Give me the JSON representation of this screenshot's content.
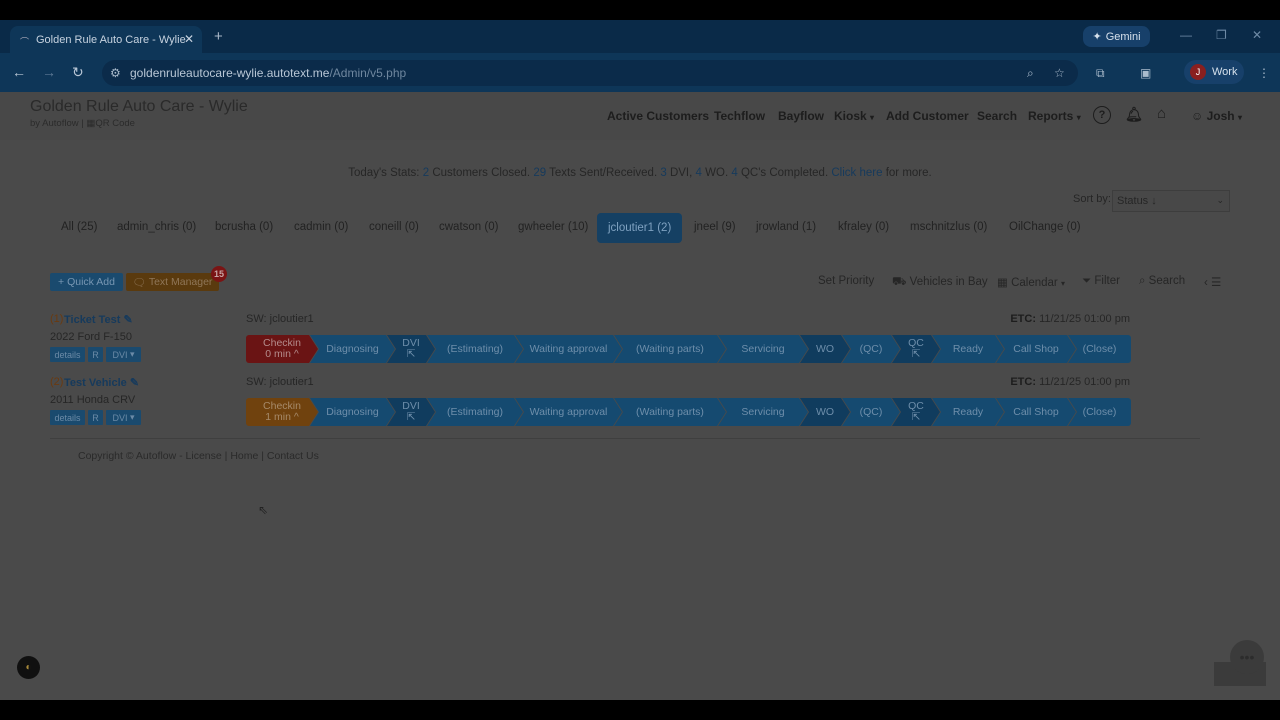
{
  "browser": {
    "tab_title": "Golden Rule Auto Care - Wylie",
    "gemini_label": "Gemini",
    "url_host": "goldenruleautocare-wylie.autotext.me",
    "url_path": "/Admin/v5.php",
    "profile_initial": "J",
    "profile_label": "Work"
  },
  "header": {
    "brand_title": "Golden Rule Auto Care - Wylie",
    "brand_by": "by Autoflow",
    "qr_label": "QR Code",
    "menu": [
      "Active Customers",
      "Techflow",
      "Bayflow",
      "Kiosk",
      "Add Customer",
      "Search",
      "Reports"
    ],
    "user": "Josh"
  },
  "stats": {
    "prefix": "Today's Stats:",
    "closed_count": "2",
    "closed_label": "Customers Closed.",
    "texts_count": "29",
    "texts_label": "Texts Sent/Received.",
    "dvi_count": "3",
    "dvi_label": "DVI,",
    "wo_count": "4",
    "wo_label": "WO.",
    "qc_count": "4",
    "qc_label": "QC's Completed.",
    "link": "Click here",
    "suffix": "for more."
  },
  "sort": {
    "label": "Sort by:",
    "value": "Status ↓"
  },
  "user_tabs": [
    "All (25)",
    "admin_chris (0)",
    "bcrusha (0)",
    "cadmin (0)",
    "coneill (0)",
    "cwatson (0)",
    "gwheeler (10)",
    "jcloutier1 (2)",
    "jneel (9)",
    "jrowland (1)",
    "kfraley (0)",
    "mschnitzlus (0)",
    "OilChange (0)"
  ],
  "toolbar": {
    "quick_add": "+ Quick Add",
    "text_manager": "Text Manager",
    "text_badge": "15",
    "set_priority": "Set Priority",
    "vehicles_in_bay": "Vehicles in Bay",
    "calendar": "Calendar",
    "filter": "Filter",
    "search": "Search"
  },
  "customers": [
    {
      "num": "(1)",
      "name": "Ticket Test",
      "vehicle": "2022 Ford F-150",
      "sw": "SW: jcloutier1",
      "etc_label": "ETC:",
      "etc_value": "11/21/25 01:00 pm",
      "checkin_line1": "Checkin",
      "checkin_line2": "0 min ^"
    },
    {
      "num": "(2)",
      "name": "Test Vehicle",
      "vehicle": "2011 Honda CRV",
      "sw": "SW: jcloutier1",
      "etc_label": "ETC:",
      "etc_value": "11/21/25 01:00 pm",
      "checkin_line1": "Checkin",
      "checkin_line2": "1 min ^"
    }
  ],
  "small_buttons": {
    "details": "details",
    "r": "R",
    "dvi": "DVI"
  },
  "stages": [
    "Diagnosing",
    "DVI",
    "(Estimating)",
    "Waiting approval",
    "(Waiting parts)",
    "Servicing",
    "WO",
    "(QC)",
    "QC",
    "Ready",
    "Call Shop",
    "(Close)"
  ],
  "footer": {
    "copyright": "Copyright © Autoflow",
    "license": "License",
    "home": "Home",
    "contact": "Contact Us"
  },
  "colors": {
    "page_overlay": "#4a4a4a",
    "active_tab": "#154063",
    "stage_blue": "#154a70",
    "checkin_red": "#6a1414",
    "checkin_orange": "#70420e"
  }
}
